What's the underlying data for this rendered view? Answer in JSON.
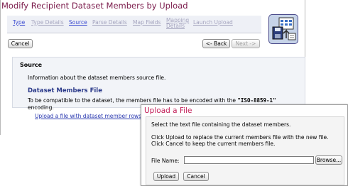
{
  "page": {
    "title": "Modify Recipient Dataset Members by Upload"
  },
  "tabs": [
    {
      "label": "Type",
      "active": true
    },
    {
      "label": "Type Details",
      "active": false
    },
    {
      "label": "Source",
      "active": true
    },
    {
      "label": "Parse Details",
      "active": false
    },
    {
      "label": "Map Fields",
      "active": false
    },
    {
      "label": "Mapping Details",
      "active": false
    },
    {
      "label": "Launch Upload",
      "active": false
    }
  ],
  "toolbar": {
    "cancel_label": "Cancel",
    "back_label": "<- Back",
    "next_label": "Next ->"
  },
  "source": {
    "heading": "Source",
    "info": "Information about the dataset members source file.",
    "file_heading": "Dataset Members File",
    "desc_text": "To be compatible to the dataset, the members file has to be encoded with the",
    "encoding": "\"ISO-8859-1\"",
    "desc_tail": "encoding.",
    "upload_link": "Upload a file with dataset member rows"
  },
  "dialog": {
    "title": "Upload a File",
    "line1": "Select the text file containing the dataset members.",
    "line2": "Click Upload to replace the current members file with the new file.",
    "line3": "Click Cancel to keep the current members file.",
    "file_label": "File Name:",
    "file_value": "",
    "browse_label": "Browse...",
    "upload_label": "Upload",
    "cancel_label": "Cancel"
  },
  "colors": {
    "title": "#7a1a4a",
    "dialog_title": "#c21d57",
    "active_tab": "#3b4bd1",
    "inactive_tab": "#a5a5bf",
    "heading": "#2b3a8a"
  },
  "icons": {
    "wizard": "upload-wizard-icon"
  }
}
